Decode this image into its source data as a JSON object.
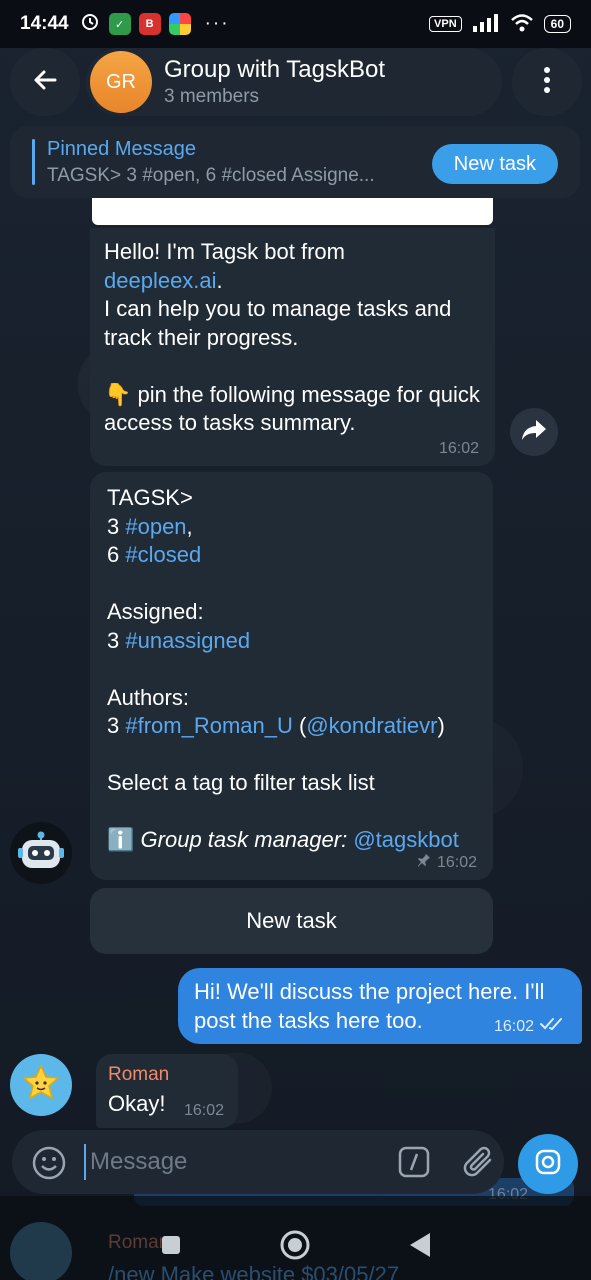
{
  "status_bar": {
    "time": "14:44",
    "vpn": "VPN",
    "battery": "60",
    "more": "···"
  },
  "header": {
    "avatar_initials": "GR",
    "title": "Group with TagskBot",
    "subtitle": "3 members"
  },
  "pinned": {
    "title": "Pinned Message",
    "body": "TAGSK> 3 #open, 6 #closed  Assigne...",
    "button_label": "New task"
  },
  "messages": {
    "m1": {
      "line1": "Hello! I'm Tagsk bot from",
      "link": "deepleex.ai",
      "dot": ".",
      "line2": "I can help you to manage tasks and track their progress.",
      "pin_emoji": "👇",
      "line3": " pin the following message for quick access to tasks summary.",
      "time": "16:02"
    },
    "m2": {
      "prefix": "TAGSK>",
      "open_count": "3 ",
      "open_tag": "#open",
      "comma": ",",
      "closed_count": "6 ",
      "closed_tag": "#closed",
      "assigned_label": "Assigned:",
      "unassigned_count": "3 ",
      "unassigned_tag": "#unassigned",
      "authors_label": "Authors:",
      "author_count": "3 ",
      "author_tag": "#from_Roman_U",
      "author_open_paren": " (",
      "author_handle": "@kondratievr",
      "author_close_paren": ")",
      "select_hint": "Select a tag to filter task list",
      "info_emoji": "ℹ️",
      "footer_label": "Group task manager: ",
      "footer_handle": "@tagskbot",
      "time": "16:02"
    },
    "keyboard_button": "New task",
    "m3": {
      "text": "Hi! We'll discuss the project here. I'll post the tasks here too.",
      "time": "16:02"
    },
    "m4": {
      "sender": "Roman",
      "text": "Okay!",
      "time": "16:02"
    }
  },
  "faded": {
    "time": "16:02",
    "sender": "Roman",
    "text": "/new Make website $03/05/27"
  },
  "input": {
    "placeholder": "Message"
  },
  "colors": {
    "accent": "#5aa8ef",
    "outgoing_bubble": "#2f84e0",
    "incoming_bubble": "#212b36",
    "sender_name": "#f08a6a",
    "avatar_gr": "#f0982f"
  }
}
